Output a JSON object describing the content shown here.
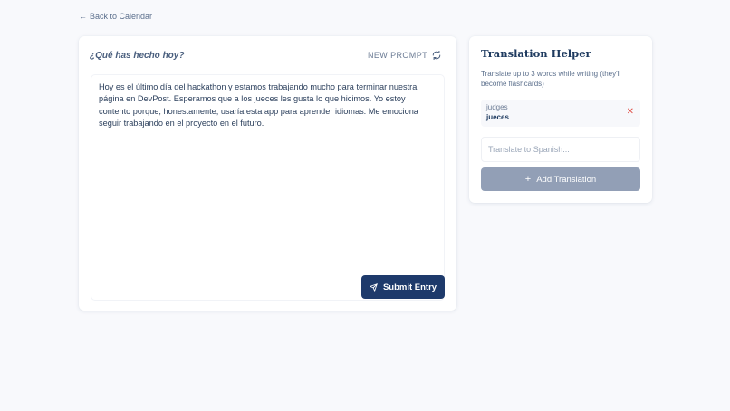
{
  "nav": {
    "back_icon": "arrow-left-icon",
    "back_label": "Back to Calendar"
  },
  "entry": {
    "prompt": "¿Qué has hecho hoy?",
    "new_prompt_label": "NEW PROMPT",
    "new_prompt_icon": "refresh-icon",
    "text": "Hoy es el último día del hackathon y estamos trabajando mucho para terminar nuestra página en DevPost. Esperamos que a los jueces les gusta lo que hicimos. Yo estoy contento porque, honestamente, usaría esta app para aprender idiomas. Me emociona seguir trabajando en el proyecto en el futuro.",
    "submit_label": "Submit Entry",
    "submit_icon": "send-icon"
  },
  "helper": {
    "title": "Translation Helper",
    "description": "Translate up to 3 words while writing (they'll become flashcards)",
    "words": [
      {
        "source": "judges",
        "target": "jueces",
        "remove_icon": "close-icon"
      }
    ],
    "input_placeholder": "Translate to Spanish...",
    "input_value": "",
    "add_label": "Add Translation",
    "add_icon": "plus-icon"
  },
  "colors": {
    "background": "#f8f9fc",
    "primary": "#1e3a6b",
    "disabled_button": "#929fb6",
    "remove": "#e0524a"
  }
}
